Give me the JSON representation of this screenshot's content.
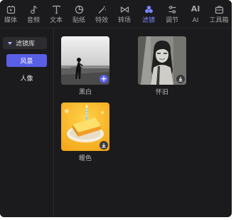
{
  "toolbar": {
    "tabs": [
      {
        "label": "媒体",
        "icon": "media-icon",
        "active": false
      },
      {
        "label": "音频",
        "icon": "music-note-icon",
        "active": false
      },
      {
        "label": "文本",
        "icon": "text-icon",
        "active": false
      },
      {
        "label": "贴纸",
        "icon": "sticker-icon",
        "active": false
      },
      {
        "label": "特效",
        "icon": "magic-wand-icon",
        "active": false
      },
      {
        "label": "转场",
        "icon": "transition-icon",
        "active": false
      },
      {
        "label": "滤镜",
        "icon": "filter-icon",
        "active": true
      },
      {
        "label": "调节",
        "icon": "adjust-sliders-icon",
        "active": false
      },
      {
        "label": "AI",
        "icon": "ai-icon",
        "icon_text": "AI",
        "active": false
      },
      {
        "label": "工具箱",
        "icon": "toolbox-icon",
        "active": false
      }
    ],
    "active_color": "#7b84ff"
  },
  "sidebar": {
    "header": "滤镜库",
    "categories": [
      {
        "label": "风景",
        "active": true
      },
      {
        "label": "人像",
        "active": false
      }
    ],
    "accent_color": "#5a5fe8"
  },
  "filters": [
    {
      "name": "黑白",
      "badge": "add"
    },
    {
      "name": "怀旧",
      "badge": "download"
    },
    {
      "name": "暖色",
      "badge": "download"
    }
  ]
}
